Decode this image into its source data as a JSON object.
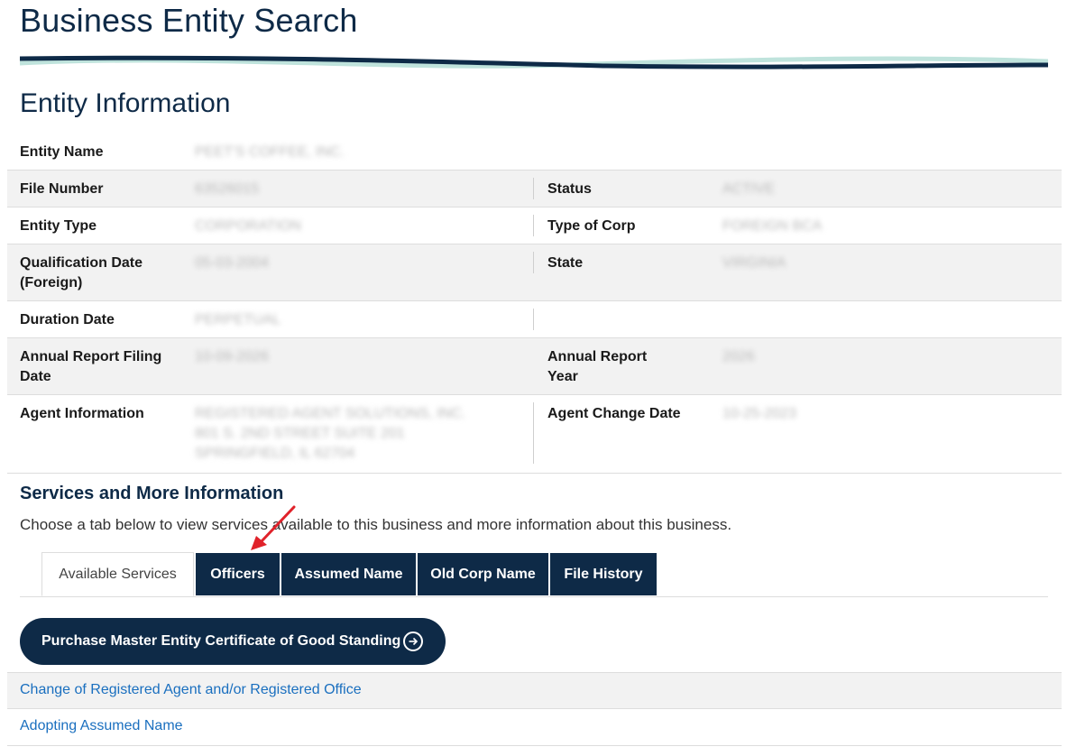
{
  "page": {
    "title": "Business Entity Search",
    "section_title": "Entity Information"
  },
  "entity": {
    "name_label": "Entity Name",
    "name_value": "PEET'S COFFEE, INC.",
    "file_label": "File Number",
    "file_value": "63526015",
    "status_label": "Status",
    "status_value": "ACTIVE",
    "type_label": "Entity Type",
    "type_value": "CORPORATION",
    "corp_label": "Type of Corp",
    "corp_value": "FOREIGN BCA",
    "qual_label_1": "Qualification Date",
    "qual_label_2": "(Foreign)",
    "qual_value": "05-03-2004",
    "state_label": "State",
    "state_value": "VIRGINIA",
    "duration_label": "Duration Date",
    "duration_value": "PERPETUAL",
    "arfd_label_1": "Annual Report Filing",
    "arfd_label_2": "Date",
    "arfd_value": "10-09-2026",
    "ary_label_1": "Annual Report",
    "ary_label_2": "Year",
    "ary_value": "2026",
    "agent_label": "Agent Information",
    "agent_line1": "REGISTERED AGENT SOLUTIONS, INC.",
    "agent_line2": "801 S. 2ND STREET SUITE 201",
    "agent_line3": "SPRINGFIELD, IL 62704",
    "agent_change_label": "Agent Change Date",
    "agent_change_value": "10-25-2023"
  },
  "services": {
    "title": "Services and More Information",
    "description": "Choose a tab below to view services available to this business and more information about this business.",
    "tabs": [
      "Available Services",
      "Officers",
      "Assumed Name",
      "Old Corp Name",
      "File History"
    ],
    "cta_label": "Purchase Master Entity Certificate of Good Standing",
    "cta_icon": "arrow-circle-right-icon",
    "links": [
      "Change of Registered Agent and/or Registered Office",
      "Adopting Assumed Name"
    ]
  },
  "colors": {
    "navy": "#0e2a47",
    "link": "#1a6fbf",
    "teal": "#bfe3dc",
    "annotation": "#e0222a"
  }
}
